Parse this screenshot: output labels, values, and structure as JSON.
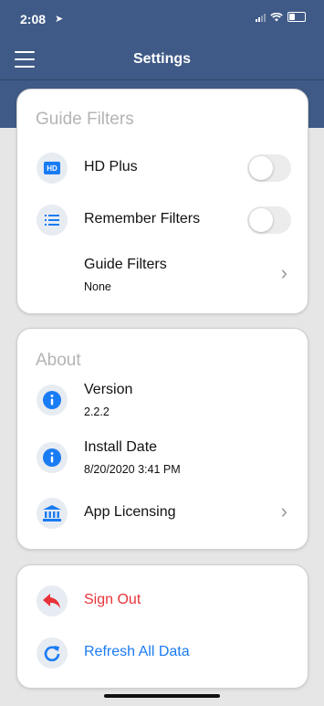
{
  "status_bar": {
    "time": "2:08",
    "location_glyph": "➤"
  },
  "nav": {
    "title": "Settings"
  },
  "guide_filters": {
    "section_title": "Guide Filters",
    "hd_plus": {
      "icon_text": "HD",
      "label": "HD Plus",
      "enabled": false
    },
    "remember_filters": {
      "label": "Remember Filters",
      "enabled": false
    },
    "guide_filters_row": {
      "label": "Guide Filters",
      "value": "None"
    }
  },
  "about": {
    "section_title": "About",
    "version": {
      "label": "Version",
      "value": "2.2.2"
    },
    "install_date": {
      "label": "Install Date",
      "value": "8/20/2020 3:41 PM"
    },
    "app_licensing": {
      "label": "App Licensing"
    }
  },
  "actions": {
    "sign_out": {
      "label": "Sign Out"
    },
    "refresh": {
      "label": "Refresh All Data"
    }
  },
  "colors": {
    "header": "#3f5a86",
    "accent_blue": "#1a7cf3",
    "danger_red": "#e8333a",
    "section_gray": "#b4b4b4"
  }
}
